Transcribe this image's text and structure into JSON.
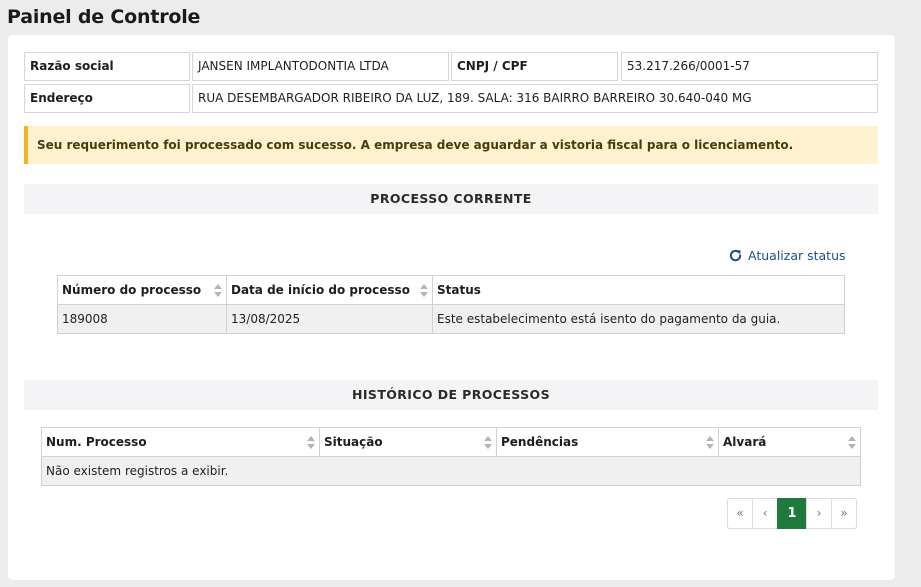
{
  "page": {
    "title": "Painel de Controle"
  },
  "company": {
    "razao_label": "Razão social",
    "razao_value": "JANSEN IMPLANTODONTIA LTDA",
    "cnpj_label": "CNPJ / CPF",
    "cnpj_value": "53.217.266/0001-57",
    "endereco_label": "Endereço",
    "endereco_value": "RUA DESEMBARGADOR RIBEIRO DA LUZ, 189. SALA: 316 BAIRRO BARREIRO 30.640-040 MG"
  },
  "alert": {
    "text": "Seu requerimento foi processado com sucesso. A empresa deve aguardar a vistoria fiscal para o licenciamento.",
    "color": "#fdf1cf",
    "accent": "#f2b51d"
  },
  "current": {
    "section_title": "PROCESSO CORRENTE",
    "refresh_label": "Atualizar status",
    "refresh_icon": "refresh-icon",
    "columns": [
      "Número do processo",
      "Data de início do processo",
      "Status"
    ],
    "rows": [
      [
        "189008",
        "13/08/2025",
        "Este estabelecimento está isento do pagamento da guia."
      ]
    ]
  },
  "history": {
    "section_title": "HISTÓRICO DE PROCESSOS",
    "columns": [
      "Num. Processo",
      "Situação",
      "Pendências",
      "Alvará"
    ],
    "empty_message": "Não existem registros a exibir."
  },
  "pagination": {
    "first": "«",
    "prev": "‹",
    "current": "1",
    "next": "›",
    "last": "»",
    "active_color": "#1f7a3d"
  }
}
